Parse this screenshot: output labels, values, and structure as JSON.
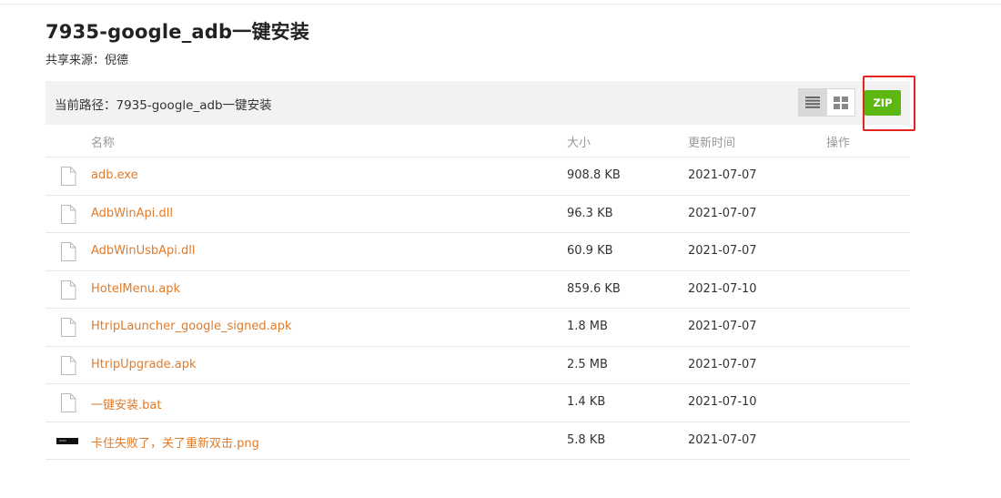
{
  "page": {
    "title": "7935-google_adb一键安装",
    "source": "共享来源：倪德"
  },
  "pathbar": {
    "label": "当前路径：7935-google_adb一键安装",
    "zip_label": "ZIP"
  },
  "table": {
    "headers": {
      "name": "名称",
      "size": "大小",
      "updated": "更新时间",
      "action": "操作"
    },
    "rows": [
      {
        "name": "adb.exe",
        "size": "908.8 KB",
        "date": "2021-07-07",
        "icon": "file-icon"
      },
      {
        "name": "AdbWinApi.dll",
        "size": "96.3 KB",
        "date": "2021-07-07",
        "icon": "file-icon"
      },
      {
        "name": "AdbWinUsbApi.dll",
        "size": "60.9 KB",
        "date": "2021-07-07",
        "icon": "file-icon"
      },
      {
        "name": "HotelMenu.apk",
        "size": "859.6 KB",
        "date": "2021-07-10",
        "icon": "file-icon"
      },
      {
        "name": "HtripLauncher_google_signed.apk",
        "size": "1.8 MB",
        "date": "2021-07-07",
        "icon": "file-icon"
      },
      {
        "name": "HtripUpgrade.apk",
        "size": "2.5 MB",
        "date": "2021-07-07",
        "icon": "file-icon"
      },
      {
        "name": "一键安装.bat",
        "size": "1.4 KB",
        "date": "2021-07-10",
        "icon": "file-icon"
      },
      {
        "name": "卡住失败了，关了重新双击.png",
        "size": "5.8 KB",
        "date": "2021-07-07",
        "icon": "image-thumbnail"
      }
    ]
  },
  "colors": {
    "link": "#e07b2a",
    "zip": "#5cb811",
    "highlight": "#e5231f"
  }
}
